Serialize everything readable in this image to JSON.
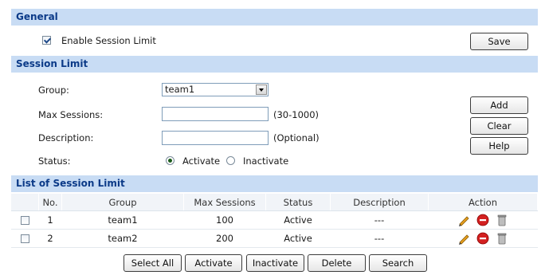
{
  "general": {
    "header": "General",
    "enable_session_limit_label": "Enable Session Limit",
    "enable_session_limit_checked": true,
    "save_label": "Save"
  },
  "session_limit": {
    "header": "Session Limit",
    "group_label": "Group:",
    "group_value": "team1",
    "max_sessions_label": "Max Sessions:",
    "max_sessions_value": "",
    "max_sessions_hint": "(30-1000)",
    "description_label": "Description:",
    "description_value": "",
    "description_hint": "(Optional)",
    "status_label": "Status:",
    "status_activate": "Activate",
    "status_inactivate": "Inactivate",
    "status_selected": "Activate",
    "add_label": "Add",
    "clear_label": "Clear",
    "help_label": "Help"
  },
  "list": {
    "header": "List of Session Limit",
    "columns": [
      "No.",
      "Group",
      "Max Sessions",
      "Status",
      "Description",
      "Action"
    ],
    "rows": [
      {
        "no": "1",
        "group": "team1",
        "max_sessions": "100",
        "status": "Active",
        "description": "---"
      },
      {
        "no": "2",
        "group": "team2",
        "max_sessions": "200",
        "status": "Active",
        "description": "---"
      }
    ],
    "row_icons": [
      "edit-pencil-icon",
      "disable-icon",
      "delete-trash-icon"
    ]
  },
  "bottom_buttons": {
    "select_all": "Select All",
    "activate": "Activate",
    "inactivate": "Inactivate",
    "delete": "Delete",
    "search": "Search"
  },
  "colors": {
    "section_header_bg": "#c8dcf4",
    "section_header_text": "#0b3a88"
  }
}
